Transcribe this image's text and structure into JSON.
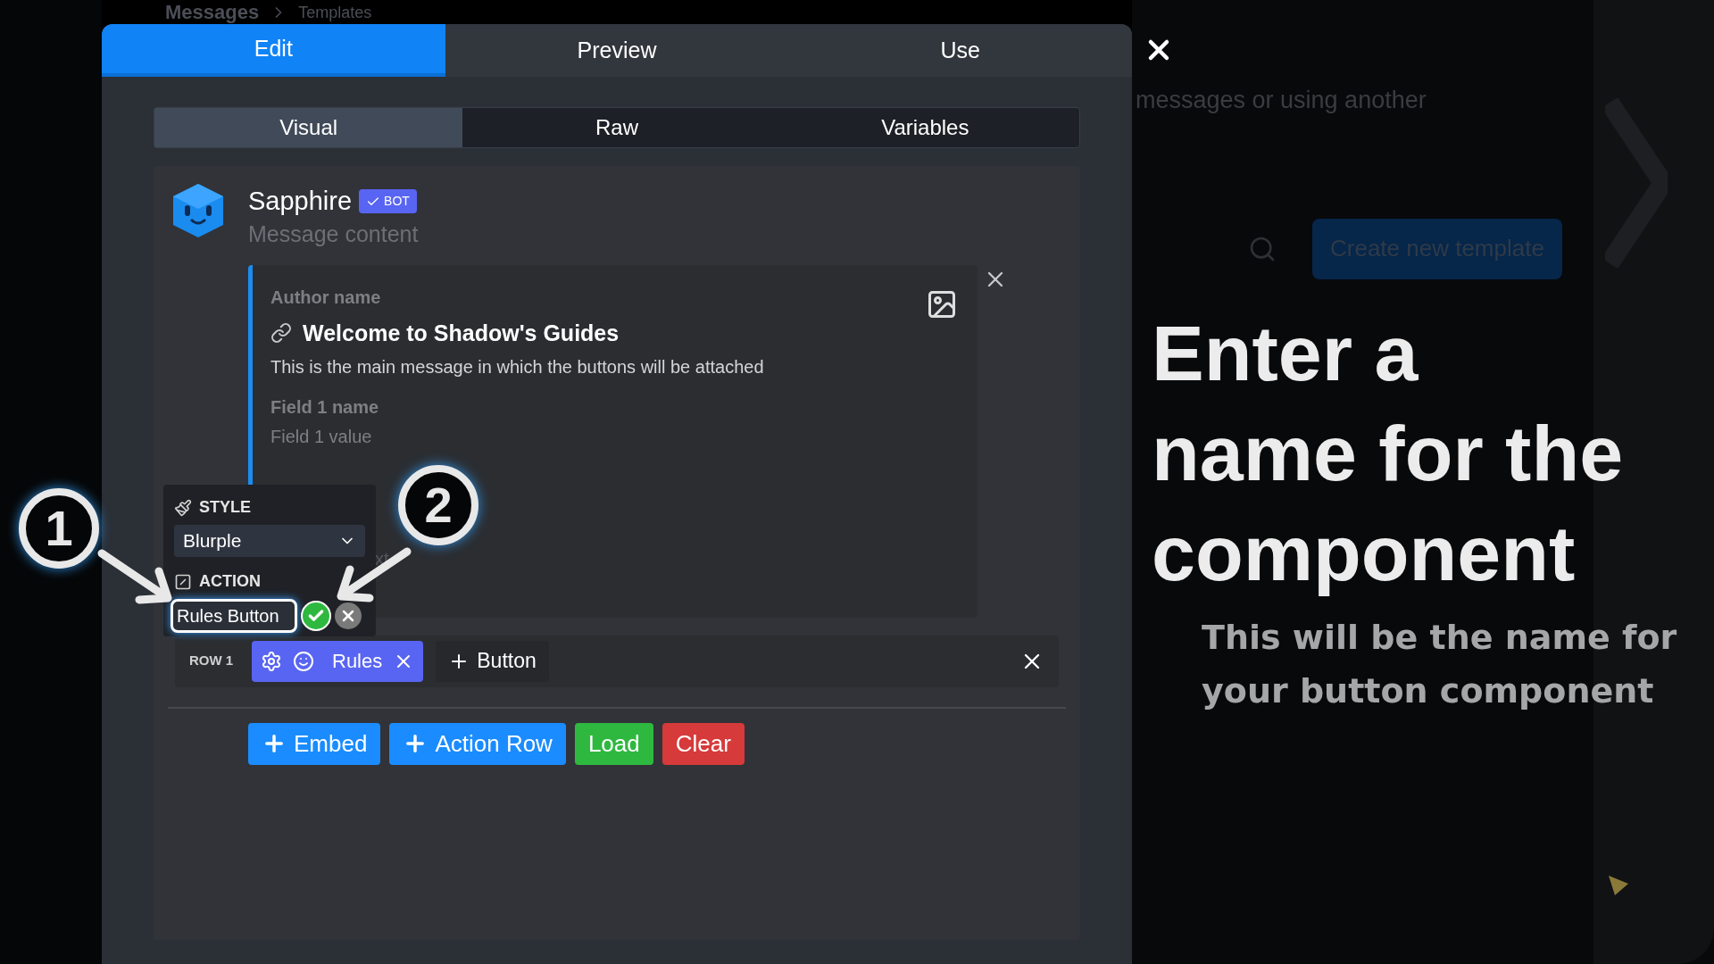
{
  "background_page": {
    "title": "Messages",
    "breadcrumb": "Templates",
    "description": "messages or using another",
    "create_button": "Create new template"
  },
  "modal": {
    "tabs": [
      {
        "label": "Edit",
        "selected": true
      },
      {
        "label": "Preview",
        "selected": false
      },
      {
        "label": "Use",
        "selected": false
      }
    ],
    "subtabs": [
      {
        "label": "Visual",
        "selected": true
      },
      {
        "label": "Raw",
        "selected": false
      },
      {
        "label": "Variables",
        "selected": false
      }
    ],
    "message": {
      "username": "Sapphire",
      "badge": "BOT",
      "content_placeholder": "Message content",
      "embed": {
        "author": "Author name",
        "title": "Welcome to Shadow's Guides",
        "description": "This is the main message in which the buttons will be attached",
        "field_name": "Field 1 name",
        "field_value": "Field 1 value",
        "footer": "xt"
      }
    },
    "action_row": {
      "label": "ROW 1",
      "buttons": [
        {
          "label": "Rules"
        }
      ],
      "add_button": "Button"
    },
    "actions": [
      {
        "label": "Embed",
        "kind": "add",
        "color": "#1a8cff"
      },
      {
        "label": "Action Row",
        "kind": "add",
        "color": "#1a8cff"
      },
      {
        "label": "Load",
        "kind": "plain",
        "color": "#2fb83f"
      },
      {
        "label": "Clear",
        "kind": "plain",
        "color": "#d63a3a"
      }
    ]
  },
  "popup": {
    "style_label": "STYLE",
    "style_value": "Blurple",
    "action_label": "ACTION",
    "name_value": "Rules Button"
  },
  "callouts": [
    "1",
    "2"
  ],
  "caption": {
    "title": "Enter a name for the component",
    "subtitle": "This will be the name for your button component"
  }
}
